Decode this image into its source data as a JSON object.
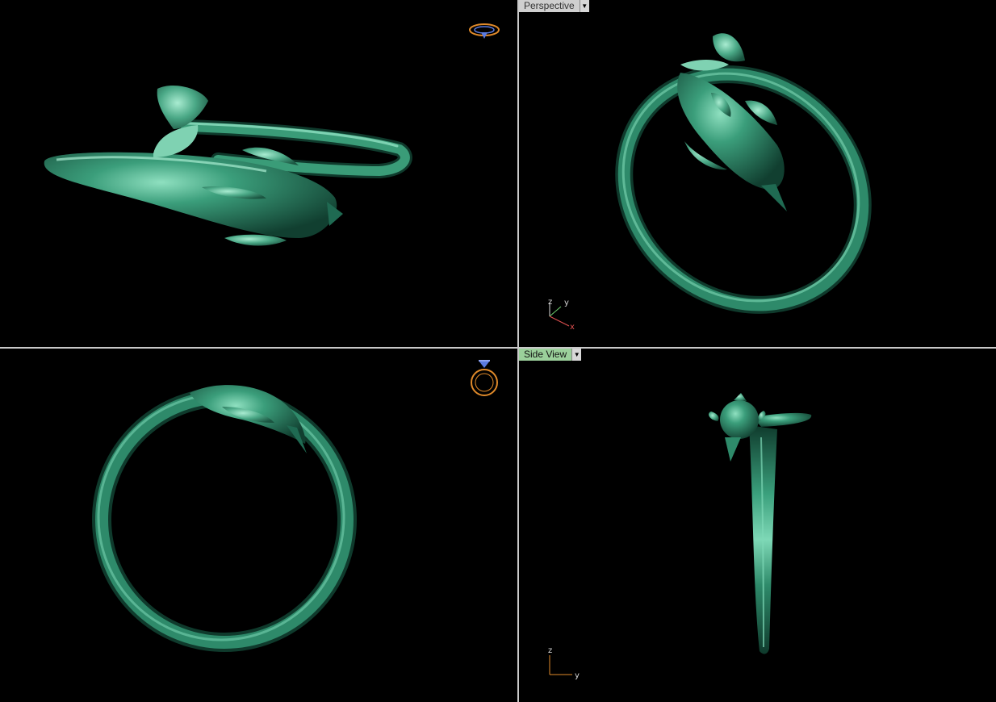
{
  "viewports": [
    {
      "id": "top-left",
      "label": null,
      "widget": "ring-orientation-icon"
    },
    {
      "id": "top-right",
      "label": "Perspective",
      "axes": [
        "z",
        "y",
        "x"
      ]
    },
    {
      "id": "bottom-left",
      "label": null,
      "widget": "ring-front-icon"
    },
    {
      "id": "bottom-right",
      "label": "Side View",
      "axes": [
        "z",
        "y"
      ]
    }
  ],
  "colors": {
    "background": "#000000",
    "model": "#2e8a6a",
    "model_highlight": "#7ed8b6",
    "model_shadow": "#0f3a2c",
    "divider": "#c9c9c9",
    "perspective_label_bg": "#cfcfcf",
    "side_view_label_bg": "#9bd09b",
    "axis_x": "#e05050",
    "widget_ring": "#e08a2a",
    "widget_gem": "#5b7be0"
  },
  "labels": {
    "perspective": "Perspective",
    "side_view": "Side View"
  },
  "axes": {
    "perspective": {
      "z": "z",
      "y": "y",
      "x": "x"
    },
    "side": {
      "z": "z",
      "y": "y"
    }
  }
}
